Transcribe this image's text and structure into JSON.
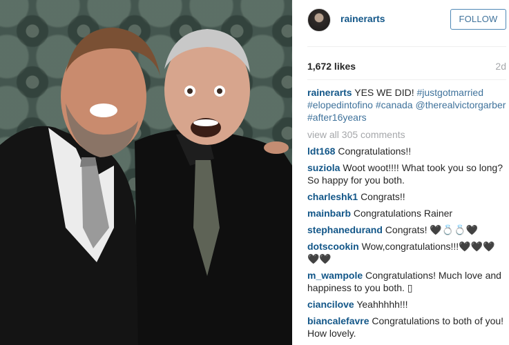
{
  "post": {
    "author": "rainerarts",
    "follow_label": "FOLLOW",
    "likes": "1,672 likes",
    "time_ago": "2d",
    "caption": {
      "username": "rainerarts",
      "text": "YES WE DID!",
      "tags": [
        "#justgotmarried",
        "#elopedintofino",
        "#canada",
        "@therealvictorgarber",
        "#after16years"
      ]
    },
    "view_all": "view all 305 comments"
  },
  "comments": [
    {
      "user": "ldt168",
      "text": "Congratulations!!"
    },
    {
      "user": "suziola",
      "text": "Woot woot!!!! What took you so long? So happy for you both."
    },
    {
      "user": "charleshk1",
      "text": "Congrats!!"
    },
    {
      "user": "mainbarb",
      "text": "Congratulations Rainer"
    },
    {
      "user": "stephanedurand",
      "text": "Congrats! 🖤💍💍🖤"
    },
    {
      "user": "dotscookin",
      "text": "Wow,congratulations!!!🖤🖤🖤🖤🖤"
    },
    {
      "user": "m_wampole",
      "text": "Congratulations! Much love and happiness to you both. ▯"
    },
    {
      "user": "ciancilove",
      "text": "Yeahhhhh!!!"
    },
    {
      "user": "biancalefavre",
      "text": "Congratulations to both of you! How lovely."
    }
  ],
  "colors": {
    "link": "#125688",
    "hashtag": "#3f729b",
    "muted": "#a5a7aa",
    "follow_border": "#4d87b5"
  }
}
